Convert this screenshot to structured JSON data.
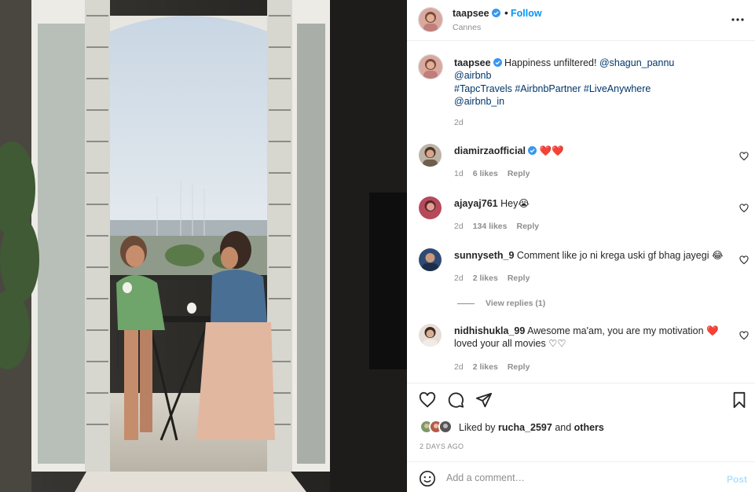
{
  "post": {
    "username": "taapsee",
    "follow_label": "Follow",
    "dot": "•",
    "location": "Cannes"
  },
  "caption": {
    "username": "taapsee",
    "text_plain": "Happiness unfiltered! ",
    "mention1": "@shagun_pannu",
    "mention2": "@airbnb",
    "hashtags": "#TapcTravels #AirbnbPartner #LiveAnywhere",
    "mention3": "@airbnb_in",
    "time": "2d"
  },
  "comments": [
    {
      "username": "diamirzaofficial",
      "verified": true,
      "text": "❤️❤️",
      "time": "1d",
      "likes": "6 likes",
      "reply": "Reply"
    },
    {
      "username": "ajayaj761",
      "verified": false,
      "text": "Hey😭",
      "time": "2d",
      "likes": "134 likes",
      "reply": "Reply"
    },
    {
      "username": "sunnyseth_9",
      "verified": false,
      "text": "Comment like jo ni krega uski gf bhag jayegi 😂",
      "time": "2d",
      "likes": "2 likes",
      "reply": "Reply",
      "view_replies": "View replies (1)"
    },
    {
      "username": "nidhishukla_99",
      "verified": false,
      "text": "Awesome ma'am, you are my motivation ❤️ loved your all movies ♡♡",
      "time": "2d",
      "likes": "2 likes",
      "reply": "Reply"
    }
  ],
  "likes": {
    "prefix": "Liked by ",
    "user": "rucha_2597",
    "mid": " and ",
    "others": "others"
  },
  "days_ago": "2 DAYS AGO",
  "add_comment": {
    "placeholder": "Add a comment…",
    "post_label": "Post"
  },
  "icons": {
    "verified": "verified-badge-icon",
    "more": "more-options-icon",
    "like": "heart-icon",
    "comment": "comment-icon",
    "share": "share-icon",
    "save": "bookmark-icon",
    "emoji": "emoji-icon"
  },
  "colors": {
    "accent": "#0095f6",
    "verified": "#3897f0",
    "link": "#00376b",
    "muted": "#8e8e8e",
    "heart": "#ed4956",
    "post_disabled": "#b2dffc"
  }
}
